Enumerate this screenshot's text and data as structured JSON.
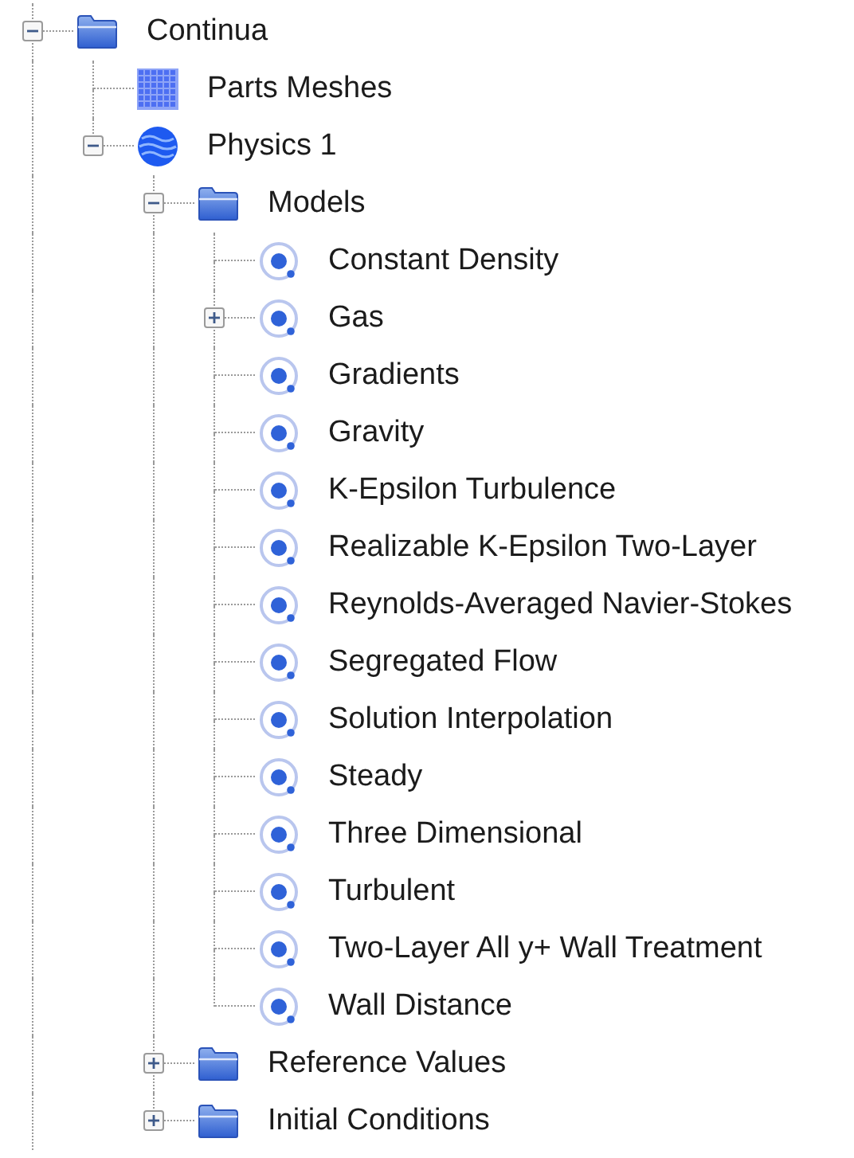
{
  "tree": [
    {
      "label": "Continua",
      "kind": "folder",
      "expanded": true,
      "children": [
        {
          "label": "Parts Meshes",
          "kind": "mesh"
        },
        {
          "label": "Physics 1",
          "kind": "physics",
          "expanded": true,
          "children": [
            {
              "label": "Models",
              "kind": "folder",
              "expanded": true,
              "children": [
                {
                  "label": "Constant Density",
                  "kind": "model"
                },
                {
                  "label": "Gas",
                  "kind": "model",
                  "expanded": false
                },
                {
                  "label": "Gradients",
                  "kind": "model"
                },
                {
                  "label": "Gravity",
                  "kind": "model"
                },
                {
                  "label": "K-Epsilon Turbulence",
                  "kind": "model"
                },
                {
                  "label": "Realizable K-Epsilon Two-Layer",
                  "kind": "model"
                },
                {
                  "label": "Reynolds-Averaged Navier-Stokes",
                  "kind": "model"
                },
                {
                  "label": "Segregated Flow",
                  "kind": "model"
                },
                {
                  "label": "Solution Interpolation",
                  "kind": "model"
                },
                {
                  "label": "Steady",
                  "kind": "model"
                },
                {
                  "label": "Three Dimensional",
                  "kind": "model"
                },
                {
                  "label": "Turbulent",
                  "kind": "model"
                },
                {
                  "label": "Two-Layer All y+ Wall Treatment",
                  "kind": "model"
                },
                {
                  "label": "Wall Distance",
                  "kind": "model"
                }
              ]
            },
            {
              "label": "Reference Values",
              "kind": "folder",
              "expanded": false
            },
            {
              "label": "Initial Conditions",
              "kind": "folder",
              "expanded": false
            }
          ]
        }
      ]
    }
  ]
}
